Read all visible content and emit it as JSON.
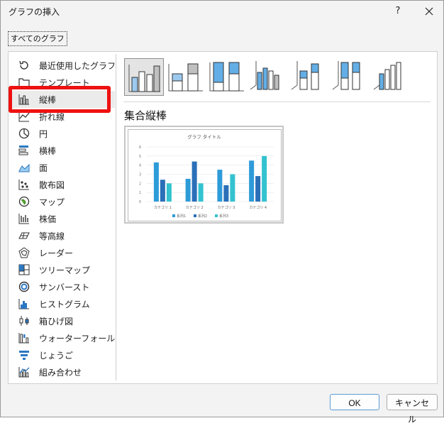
{
  "window": {
    "title": "グラフの挿入",
    "help": "?",
    "close": "×"
  },
  "tab": {
    "label": "すべてのグラフ"
  },
  "sidebar": {
    "items": [
      {
        "label": "最近使用したグラフ",
        "icon": "recent-icon"
      },
      {
        "label": "テンプレート",
        "icon": "folder-icon"
      },
      {
        "label": "縦棒",
        "icon": "column-chart-icon"
      },
      {
        "label": "折れ線",
        "icon": "line-chart-icon"
      },
      {
        "label": "円",
        "icon": "pie-chart-icon"
      },
      {
        "label": "横棒",
        "icon": "bar-chart-icon"
      },
      {
        "label": "面",
        "icon": "area-chart-icon"
      },
      {
        "label": "散布図",
        "icon": "scatter-chart-icon"
      },
      {
        "label": "マップ",
        "icon": "map-chart-icon"
      },
      {
        "label": "株価",
        "icon": "stock-chart-icon"
      },
      {
        "label": "等高線",
        "icon": "surface-chart-icon"
      },
      {
        "label": "レーダー",
        "icon": "radar-chart-icon"
      },
      {
        "label": "ツリーマップ",
        "icon": "treemap-chart-icon"
      },
      {
        "label": "サンバースト",
        "icon": "sunburst-chart-icon"
      },
      {
        "label": "ヒストグラム",
        "icon": "histogram-chart-icon"
      },
      {
        "label": "箱ひげ図",
        "icon": "boxplot-chart-icon"
      },
      {
        "label": "ウォーターフォール",
        "icon": "waterfall-chart-icon"
      },
      {
        "label": "じょうご",
        "icon": "funnel-chart-icon"
      },
      {
        "label": "組み合わせ",
        "icon": "combo-chart-icon"
      }
    ],
    "selected_index": 2
  },
  "subtypes": {
    "heading": "集合縦棒",
    "items": [
      "clustered-column-icon",
      "stacked-column-icon",
      "100-stacked-column-icon",
      "3d-clustered-column-icon",
      "3d-stacked-column-icon",
      "3d-100-stacked-column-icon",
      "3d-column-icon"
    ]
  },
  "chart_data": {
    "type": "bar",
    "title": "グラフ タイトル",
    "categories": [
      "カテゴリ 1",
      "カテゴリ 2",
      "カテゴリ 3",
      "カテゴリ 4"
    ],
    "series": [
      {
        "name": "系列1",
        "values": [
          4.3,
          2.5,
          3.5,
          4.5
        ],
        "color": "#2e9bd9"
      },
      {
        "name": "系列2",
        "values": [
          2.4,
          4.4,
          1.8,
          2.8
        ],
        "color": "#2a6fb8"
      },
      {
        "name": "系列3",
        "values": [
          2.0,
          2.0,
          3.0,
          5.0
        ],
        "color": "#33c2cf"
      }
    ],
    "yticks": [
      "0",
      "1",
      "2",
      "3",
      "4",
      "5",
      "6"
    ],
    "ylim": [
      0,
      6
    ],
    "legend": "bottom",
    "grid": true
  },
  "buttons": {
    "ok": "OK",
    "cancel": "キャンセル"
  }
}
